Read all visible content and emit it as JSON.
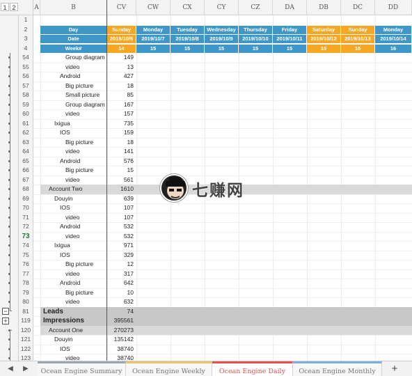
{
  "outline_levels": [
    "1",
    "2"
  ],
  "columns": [
    "A",
    "B",
    "CV",
    "CW",
    "CX",
    "CY",
    "CZ",
    "DA",
    "DB",
    "DC",
    "DD"
  ],
  "header_rows": {
    "row_numbers": [
      "1",
      "2",
      "3",
      "4"
    ],
    "labels": {
      "day": "Day",
      "date": "Date",
      "week": "Week#"
    },
    "days": [
      {
        "day": "Sunday",
        "date": "2019/10/6",
        "week": "14",
        "weekend": true
      },
      {
        "day": "Monday",
        "date": "2019/10/7",
        "week": "15",
        "weekend": false
      },
      {
        "day": "Tuesday",
        "date": "2019/10/8",
        "week": "15",
        "weekend": false
      },
      {
        "day": "Wednesday",
        "date": "2019/10/9",
        "week": "15",
        "weekend": false
      },
      {
        "day": "Thursday",
        "date": "2019/10/10",
        "week": "15",
        "weekend": false
      },
      {
        "day": "Friday",
        "date": "2019/10/11",
        "week": "15",
        "weekend": false
      },
      {
        "day": "Saturday",
        "date": "2019/10/12",
        "week": "15",
        "weekend": true
      },
      {
        "day": "Sunday",
        "date": "2019/10/13",
        "week": "15",
        "weekend": true
      },
      {
        "day": "Monday",
        "date": "2019/10/14",
        "week": "16",
        "weekend": false
      }
    ]
  },
  "rows": [
    {
      "num": "54",
      "label": "Group diagram",
      "indent": 4,
      "value": "149"
    },
    {
      "num": "55",
      "label": "video",
      "indent": 4,
      "value": "13"
    },
    {
      "num": "56",
      "label": "Android",
      "indent": 3,
      "value": "427"
    },
    {
      "num": "57",
      "label": "Big picture",
      "indent": 4,
      "value": "18"
    },
    {
      "num": "58",
      "label": "Small picture",
      "indent": 4,
      "value": "85"
    },
    {
      "num": "59",
      "label": "Group diagram",
      "indent": 4,
      "value": "167"
    },
    {
      "num": "60",
      "label": "video",
      "indent": 4,
      "value": "157"
    },
    {
      "num": "61",
      "label": "Ixigua",
      "indent": 2,
      "value": "735"
    },
    {
      "num": "62",
      "label": "IOS",
      "indent": 3,
      "value": "159"
    },
    {
      "num": "63",
      "label": "Big picture",
      "indent": 4,
      "value": "18"
    },
    {
      "num": "64",
      "label": "video",
      "indent": 4,
      "value": "141"
    },
    {
      "num": "65",
      "label": "Android",
      "indent": 3,
      "value": "576"
    },
    {
      "num": "66",
      "label": "Big picture",
      "indent": 4,
      "value": "15"
    },
    {
      "num": "67",
      "label": "video",
      "indent": 4,
      "value": "561"
    },
    {
      "num": "68",
      "label": "Account Two",
      "indent": 1,
      "value": "1610",
      "band": "account"
    },
    {
      "num": "69",
      "label": "Douyin",
      "indent": 2,
      "value": "639"
    },
    {
      "num": "70",
      "label": "IOS",
      "indent": 3,
      "value": "107"
    },
    {
      "num": "71",
      "label": "video",
      "indent": 4,
      "value": "107"
    },
    {
      "num": "72",
      "label": "Android",
      "indent": 3,
      "value": "532"
    },
    {
      "num": "73",
      "label": "video",
      "indent": 4,
      "value": "532",
      "active": true
    },
    {
      "num": "74",
      "label": "Ixigua",
      "indent": 2,
      "value": "971"
    },
    {
      "num": "75",
      "label": "IOS",
      "indent": 3,
      "value": "329"
    },
    {
      "num": "76",
      "label": "Big picture",
      "indent": 4,
      "value": "12"
    },
    {
      "num": "77",
      "label": "video",
      "indent": 4,
      "value": "317"
    },
    {
      "num": "78",
      "label": "Android",
      "indent": 3,
      "value": "642"
    },
    {
      "num": "79",
      "label": "Big picture",
      "indent": 4,
      "value": "10"
    },
    {
      "num": "80",
      "label": "video",
      "indent": 4,
      "value": "632"
    },
    {
      "num": "81",
      "label": "Leads",
      "indent": 0,
      "value": "74",
      "band": "section"
    },
    {
      "num": "119",
      "label": "Impressions",
      "indent": 0,
      "value": "395561",
      "band": "section"
    },
    {
      "num": "120",
      "label": "Account One",
      "indent": 1,
      "value": "270273",
      "band": "account"
    },
    {
      "num": "121",
      "label": "Douyin",
      "indent": 2,
      "value": "135142"
    },
    {
      "num": "122",
      "label": "IOS",
      "indent": 3,
      "value": "38740"
    },
    {
      "num": "123",
      "label": "video",
      "indent": 4,
      "value": "38740"
    }
  ],
  "sheet_tabs": [
    {
      "label": "Ocean Engine Summary",
      "accent": "#9aa7b3",
      "active": false
    },
    {
      "label": "Ocean Engine Weekly",
      "accent": "#e9c46a",
      "active": false
    },
    {
      "label": "Ocean Engine Daily",
      "accent": "#e45050",
      "active": true
    },
    {
      "label": "Ocean Engine Monthly",
      "accent": "#7fb0dd",
      "active": false
    }
  ],
  "tab_nav": {
    "prev": "◀",
    "next": "▶",
    "add": "+"
  },
  "outline_controls": {
    "collapse": "−",
    "expand": "+"
  },
  "watermark": {
    "text": "七赚网"
  },
  "colors": {
    "header_blue": "#3e97c8",
    "weekend_orange": "#f5a623",
    "account_band": "#d9d9d9",
    "section_band": "#c8c8c8",
    "active_row": "#1f7a3a"
  }
}
